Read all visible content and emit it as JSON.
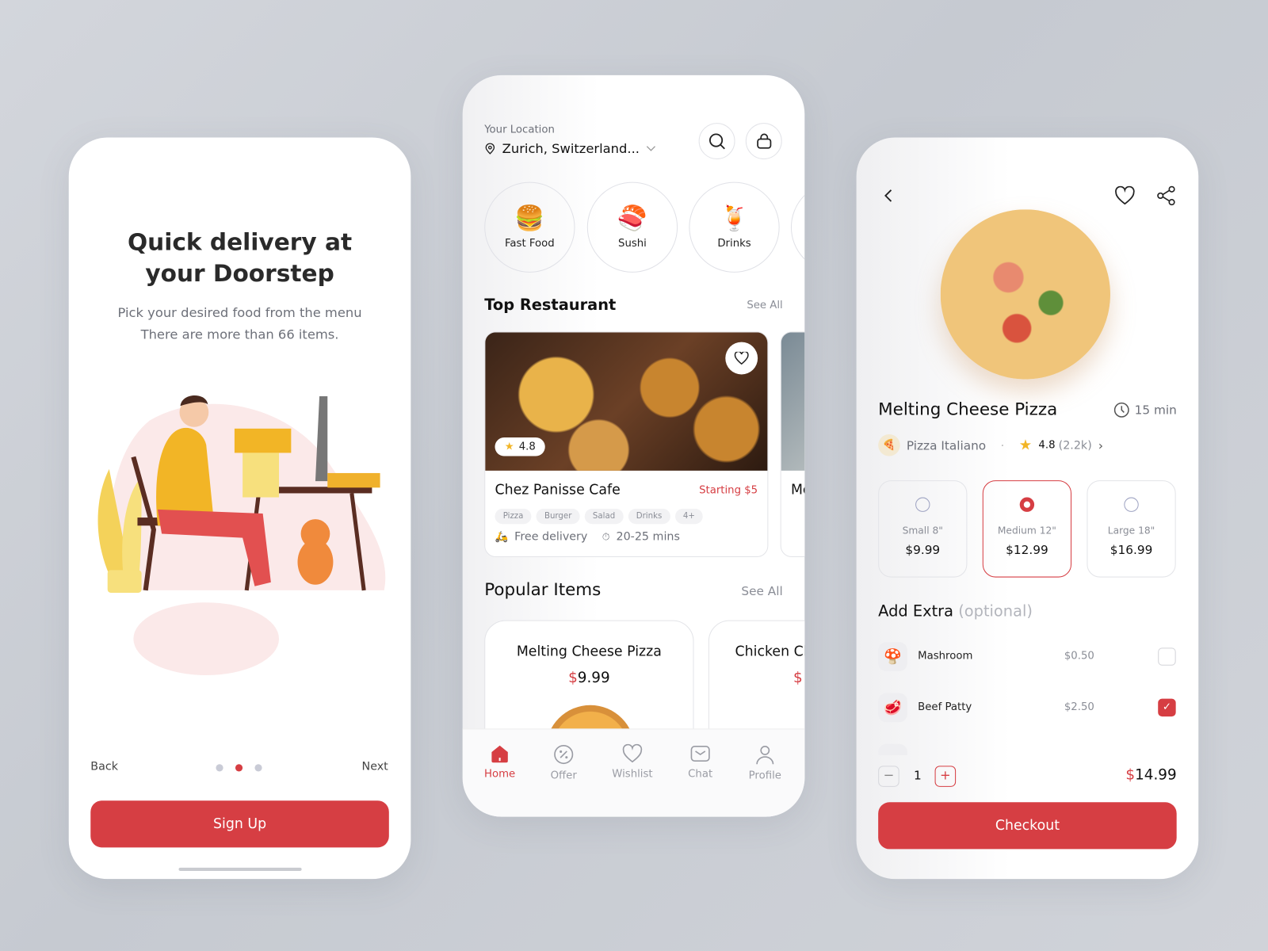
{
  "colors": {
    "accent": "#d63e43",
    "text": "#1a1a1a",
    "muted": "#8a8d96",
    "star": "#f2b526"
  },
  "onboarding": {
    "title_line1": "Quick delivery at",
    "title_line2": "your Doorstep",
    "subtitle_line1": "Pick your desired food from the menu",
    "subtitle_line2": "There are more than 66 items.",
    "back_label": "Back",
    "next_label": "Next",
    "page_dots": {
      "total": 3,
      "active": 2
    },
    "signup_label": "Sign Up"
  },
  "home": {
    "location_label": "Your Location",
    "location_value": "Zurich, Switzerland...",
    "icons": {
      "search": "search-icon",
      "cart": "shopping-bag-icon",
      "location": "location-pin-icon"
    },
    "categories": [
      {
        "label": "Fast Food",
        "icon": "🍔"
      },
      {
        "label": "Sushi",
        "icon": "🍣"
      },
      {
        "label": "Drinks",
        "icon": "🍹"
      }
    ],
    "top_restaurant": {
      "title": "Top Restaurant",
      "see_all": "See All",
      "card": {
        "name": "Chez Panisse Cafe",
        "price_note": "Starting $5",
        "rating": "4.8",
        "tags": [
          "Pizza",
          "Burger",
          "Salad",
          "Drinks",
          "4+"
        ],
        "delivery": "Free delivery",
        "time": "20-25 mins"
      },
      "next_card_name": "Mc"
    },
    "popular": {
      "title": "Popular Items",
      "see_all": "See All",
      "items": [
        {
          "name": "Melting Cheese Pizza",
          "currency": "$",
          "price": "9.99"
        },
        {
          "name": "Chicken Cl",
          "currency": "$",
          "price": ""
        }
      ]
    },
    "nav": [
      {
        "label": "Home",
        "icon": "home-icon",
        "active": true
      },
      {
        "label": "Offer",
        "icon": "discount-icon",
        "active": false
      },
      {
        "label": "Wishlist",
        "icon": "heart-icon",
        "active": false
      },
      {
        "label": "Chat",
        "icon": "chat-icon",
        "active": false
      },
      {
        "label": "Profile",
        "icon": "profile-icon",
        "active": false
      }
    ]
  },
  "detail": {
    "title": "Melting Cheese Pizza",
    "time": "15 min",
    "restaurant": "Pizza Italiano",
    "rating": "4.8",
    "reviews": "(2.2k)",
    "sizes": [
      {
        "label": "Small 8\"",
        "price": "$9.99",
        "selected": false
      },
      {
        "label": "Medium 12\"",
        "price": "$12.99",
        "selected": true
      },
      {
        "label": "Large 18\"",
        "price": "$16.99",
        "selected": false
      }
    ],
    "extra_title": "Add Extra",
    "extra_optional": "(optional)",
    "extras": [
      {
        "name": "Mashroom",
        "price": "$0.50",
        "checked": false,
        "icon": "🍄"
      },
      {
        "name": "Beef Patty",
        "price": "$2.50",
        "checked": true,
        "icon": "🥩"
      }
    ],
    "quantity": "1",
    "total_currency": "$",
    "total": "14.99",
    "checkout_label": "Checkout"
  }
}
